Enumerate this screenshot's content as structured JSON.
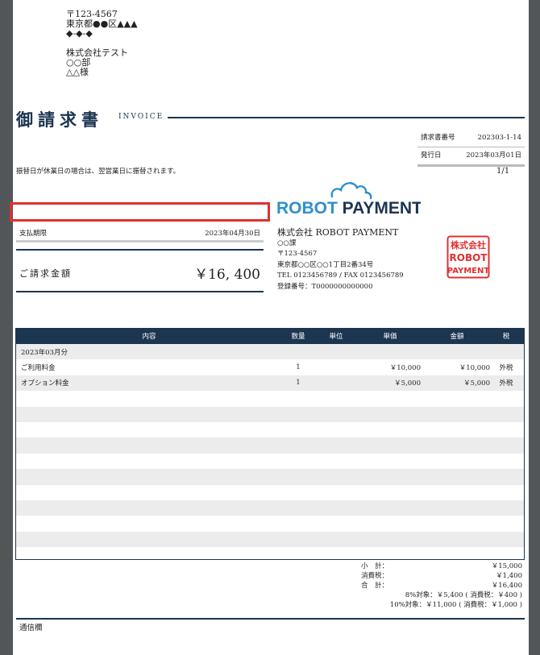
{
  "recipient": {
    "postal": "〒123-4567",
    "address1": "東京都●●区▲▲▲",
    "address2": "◆-◆-◆",
    "company": "株式会社テスト",
    "dept": "○○部",
    "person": "△△様"
  },
  "title": "御請求書",
  "title_en": "INVOICE",
  "meta": {
    "invoice_no_label": "請求書番号",
    "invoice_no": "202303-1-14",
    "issue_date_label": "発行日",
    "issue_date": "2023年03月01日"
  },
  "page_indicator": "1/1",
  "notice": "振替日が休業日の場合は、翌営業日に振替されます。",
  "due": {
    "label": "支払期限",
    "value": "2023年04月30日"
  },
  "amount": {
    "label": "ご請求金額",
    "value": "￥16, 400"
  },
  "logo": {
    "text_robot": "ROBOT",
    "text_payment": " PAYMENT",
    "color_blue": "#2e8fd0",
    "color_navy": "#1c3550"
  },
  "issuer": {
    "name": "株式会社 ROBOT PAYMENT",
    "dept": "○○課",
    "postal": "〒123-4567",
    "address": "東京都○○区○○1丁目2番34号",
    "tel_fax": "TEL 0123456789 / FAX 0123456789",
    "reg_no": "登録番号：T0000000000000"
  },
  "seal": {
    "line1": "株式会社",
    "line2": "ROBOT",
    "line3": "PAYMENT",
    "color": "#e03030"
  },
  "table": {
    "headers": {
      "item": "内容",
      "qty": "数量",
      "unit": "単位",
      "price": "単価",
      "amount": "金額",
      "tax": "税"
    },
    "rows": [
      {
        "item": "2023年03月分",
        "qty": "",
        "unit": "",
        "price": "",
        "amount": "",
        "tax": ""
      },
      {
        "item": "ご利用料金",
        "qty": "1",
        "unit": "",
        "price": "￥10,000",
        "amount": "￥10,000",
        "tax": "外税"
      },
      {
        "item": "オプション料金",
        "qty": "1",
        "unit": "",
        "price": "￥5,000",
        "amount": "￥5,000",
        "tax": "外税"
      },
      {
        "item": "",
        "qty": "",
        "unit": "",
        "price": "",
        "amount": "",
        "tax": ""
      },
      {
        "item": "",
        "qty": "",
        "unit": "",
        "price": "",
        "amount": "",
        "tax": ""
      },
      {
        "item": "",
        "qty": "",
        "unit": "",
        "price": "",
        "amount": "",
        "tax": ""
      },
      {
        "item": "",
        "qty": "",
        "unit": "",
        "price": "",
        "amount": "",
        "tax": ""
      },
      {
        "item": "",
        "qty": "",
        "unit": "",
        "price": "",
        "amount": "",
        "tax": ""
      },
      {
        "item": "",
        "qty": "",
        "unit": "",
        "price": "",
        "amount": "",
        "tax": ""
      },
      {
        "item": "",
        "qty": "",
        "unit": "",
        "price": "",
        "amount": "",
        "tax": ""
      },
      {
        "item": "",
        "qty": "",
        "unit": "",
        "price": "",
        "amount": "",
        "tax": ""
      },
      {
        "item": "",
        "qty": "",
        "unit": "",
        "price": "",
        "amount": "",
        "tax": ""
      },
      {
        "item": "",
        "qty": "",
        "unit": "",
        "price": "",
        "amount": "",
        "tax": ""
      },
      {
        "item": "",
        "qty": "",
        "unit": "",
        "price": "",
        "amount": "",
        "tax": ""
      }
    ]
  },
  "totals": {
    "subtotal_label": "小　計：",
    "subtotal": "￥15,000",
    "tax_label": "消費税：",
    "tax": "￥1,400",
    "total_label": "合　計：",
    "total": "￥16,400",
    "tax8": "8%対象：￥5,400 ( 消費税：￥400 )",
    "tax10": "10%対象：￥11,000 ( 消費税：￥1,000 )"
  },
  "memo_label": "通信欄"
}
